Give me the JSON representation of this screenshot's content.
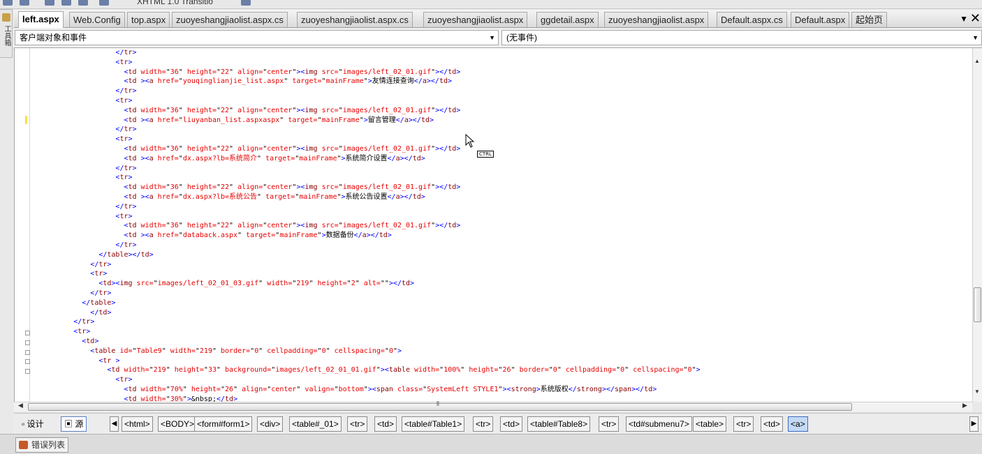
{
  "toolbar": {
    "doctype_label": "XHTML 1.0 Transitio"
  },
  "toolbox": {
    "label": "工具箱"
  },
  "tabs": [
    {
      "label": "left.aspx",
      "active": true
    },
    {
      "label": "Web.Config"
    },
    {
      "label": "top.aspx"
    },
    {
      "label": "zuoyeshangjiaolist.aspx.cs"
    },
    {
      "label": "zuoyeshangjiaolist.aspx.cs"
    },
    {
      "label": "zuoyeshangjiaolist.aspx"
    },
    {
      "label": "ggdetail.aspx"
    },
    {
      "label": "zuoyeshangjiaolist.aspx"
    },
    {
      "label": "Default.aspx.cs"
    },
    {
      "label": "Default.aspx"
    },
    {
      "label": "起始页"
    }
  ],
  "tab_controls": {
    "dropdown": "▼",
    "close": "✕"
  },
  "object_bar": {
    "objects_value": "客户端对象和事件",
    "events_value": "(无事件)"
  },
  "code_lines": [
    "                    </tr>",
    "                    <tr>",
    "                      <td width=\"36\" height=\"22\" align=\"center\"><img src=\"images/left_02_01.gif\"></td>",
    "                      <td ><a href=\"youqinglianjie_list.aspx\" target=\"mainFrame\">友情连接查询</a></td>",
    "                    </tr>",
    "                    <tr>",
    "                      <td width=\"36\" height=\"22\" align=\"center\"><img src=\"images/left_02_01.gif\"></td>",
    "                      <td ><a href=\"liuyanban_list.aspxaspx\" target=\"mainFrame\">留言管理</a></td>",
    "                    </tr>",
    "                    <tr>",
    "                      <td width=\"36\" height=\"22\" align=\"center\"><img src=\"images/left_02_01.gif\"></td>",
    "                      <td ><a href=\"dx.aspx?lb=系统简介\" target=\"mainFrame\">系统简介设置</a></td>",
    "                    </tr>",
    "                    <tr>",
    "                      <td width=\"36\" height=\"22\" align=\"center\"><img src=\"images/left_02_01.gif\"></td>",
    "                      <td ><a href=\"dx.aspx?lb=系统公告\" target=\"mainFrame\">系统公告设置</a></td>",
    "                    </tr>",
    "                    <tr>",
    "                      <td width=\"36\" height=\"22\" align=\"center\"><img src=\"images/left_02_01.gif\"></td>",
    "                      <td ><a href=\"databack.aspx\" target=\"mainFrame\">数据备份</a></td>",
    "                    </tr>",
    "                </table></td>",
    "              </tr>",
    "              <tr>",
    "                <td><img src=\"images/left_02_01_03.gif\" width=\"219\" height=\"2\" alt=\"\"></td>",
    "              </tr>",
    "            </table>",
    "              </td>",
    "          </tr>",
    "          <tr>",
    "            <td>",
    "              <table id=\"Table9\" width=\"219\" border=\"0\" cellpadding=\"0\" cellspacing=\"0\">",
    "                <tr >",
    "                  <td width=\"219\" height=\"33\" background=\"images/left_02_01_01.gif\"><table width=\"100%\" height=\"26\" border=\"0\" cellpadding=\"0\" cellspacing=\"0\">",
    "                    <tr>",
    "                      <td width=\"70%\" height=\"26\" align=\"center\" valign=\"bottom\"><span class=\"SystemLeft STYLE1\"><strong>系统版权</strong></span></td>",
    "                      <td width=\"30%\">&nbsp;</td>"
  ],
  "view_buttons": {
    "design": "设计",
    "source": "源"
  },
  "breadcrumb": [
    "<html>",
    "<BODY>",
    "<form#form1>",
    "<div>",
    "<table#_01>",
    "<tr>",
    "<td>",
    "<table#Table1>",
    "<tr>",
    "<td>",
    "<table#Table8>",
    "<tr>",
    "<td#submenu7>",
    "<table>",
    "<tr>",
    "<td>",
    "<a>"
  ],
  "error_list": {
    "label": "错误列表"
  },
  "cursor_badge": "CTRL",
  "colors": {
    "tag": "#8b0000",
    "attr": "#e80000",
    "value": "#0000ff",
    "accent": "#3b6cc2"
  }
}
